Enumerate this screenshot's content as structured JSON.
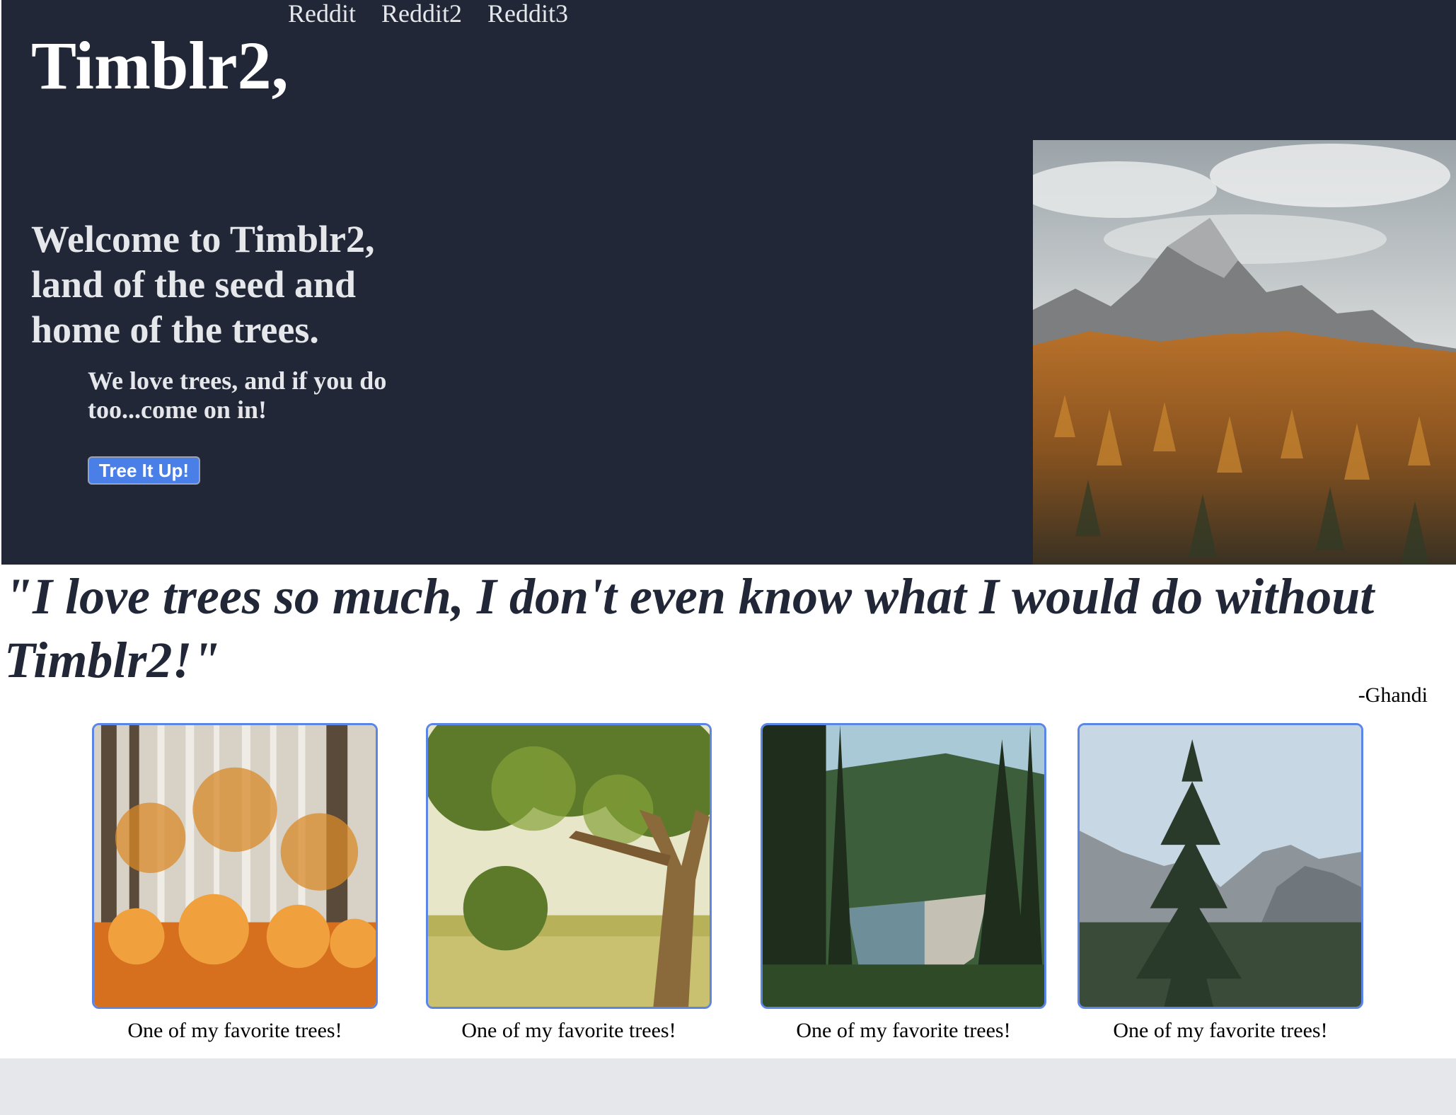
{
  "nav": {
    "links": [
      "Reddit",
      "Reddit2",
      "Reddit3"
    ]
  },
  "hero": {
    "brand": "Timblr2,",
    "welcome": "Welcome to Timblr2, land of the seed and home of the trees.",
    "tagline": "We love trees, and if you do too...come on in!",
    "cta_label": "Tree It Up!",
    "image": "mountain-autumn-forest-photo"
  },
  "testimonial": {
    "quote": "\"I love trees so much, I don't even know what I would do without Timblr2!\"",
    "author": "-Ghandi"
  },
  "gallery": {
    "items": [
      {
        "image": "autumn-birch-forest-photo",
        "caption": "One of my favorite trees!"
      },
      {
        "image": "large-oak-tree-photo",
        "caption": "One of my favorite trees!"
      },
      {
        "image": "forest-lake-photo",
        "caption": "One of my favorite trees!"
      },
      {
        "image": "pine-valley-photo",
        "caption": "One of my favorite trees!"
      }
    ]
  },
  "colors": {
    "hero_bg": "#212736",
    "button_bg": "#4a7fe8",
    "card_border": "#5b86e5",
    "page_bg": "#e5e7eb"
  }
}
